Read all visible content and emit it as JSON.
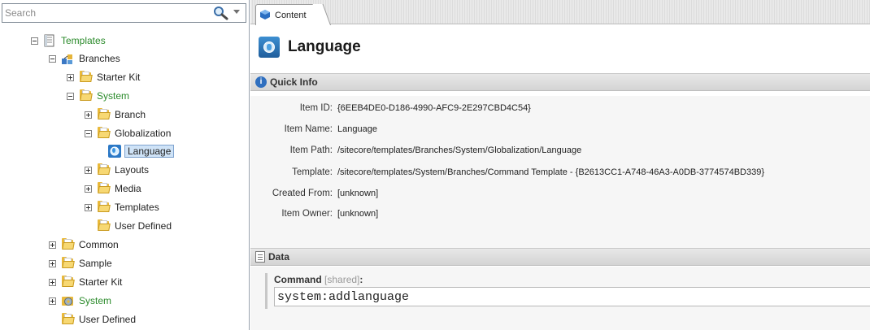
{
  "search": {
    "placeholder": "Search"
  },
  "tree": {
    "items": [
      {
        "label": "Templates",
        "green": true
      },
      {
        "label": "Branches"
      },
      {
        "label": "Starter Kit"
      },
      {
        "label": "System",
        "green": true
      },
      {
        "label": "Branch"
      },
      {
        "label": "Globalization"
      },
      {
        "label": "Language",
        "selected": true
      },
      {
        "label": "Layouts"
      },
      {
        "label": "Media"
      },
      {
        "label": "Templates"
      },
      {
        "label": "User Defined"
      },
      {
        "label": "Common"
      },
      {
        "label": "Sample"
      },
      {
        "label": "Starter Kit"
      },
      {
        "label": "System",
        "green": true
      },
      {
        "label": "User Defined"
      }
    ]
  },
  "tabs": {
    "content_label": "Content"
  },
  "header": {
    "title": "Language"
  },
  "quick_info": {
    "title": "Quick Info",
    "rows": [
      {
        "key": "Item ID:",
        "value": "{6EEB4DE0-D186-4990-AFC9-2E297CBD4C54}"
      },
      {
        "key": "Item Name:",
        "value": "Language"
      },
      {
        "key": "Item Path:",
        "value": "/sitecore/templates/Branches/System/Globalization/Language"
      },
      {
        "key": "Template:",
        "value": "/sitecore/templates/System/Branches/Command Template - {B2613CC1-A748-46A3-A0DB-3774574BD339}"
      },
      {
        "key": "Created From:",
        "value": "[unknown]"
      },
      {
        "key": "Item Owner:",
        "value": "[unknown]"
      }
    ]
  },
  "data_section": {
    "title": "Data",
    "field": {
      "label": "Command",
      "shared": "[shared]",
      "colon": ":",
      "value": "system:addlanguage"
    }
  },
  "colors": {
    "green_text": "#2a8a2a",
    "selection_bg": "#cfe3f7",
    "folder": "#e9b93a"
  }
}
